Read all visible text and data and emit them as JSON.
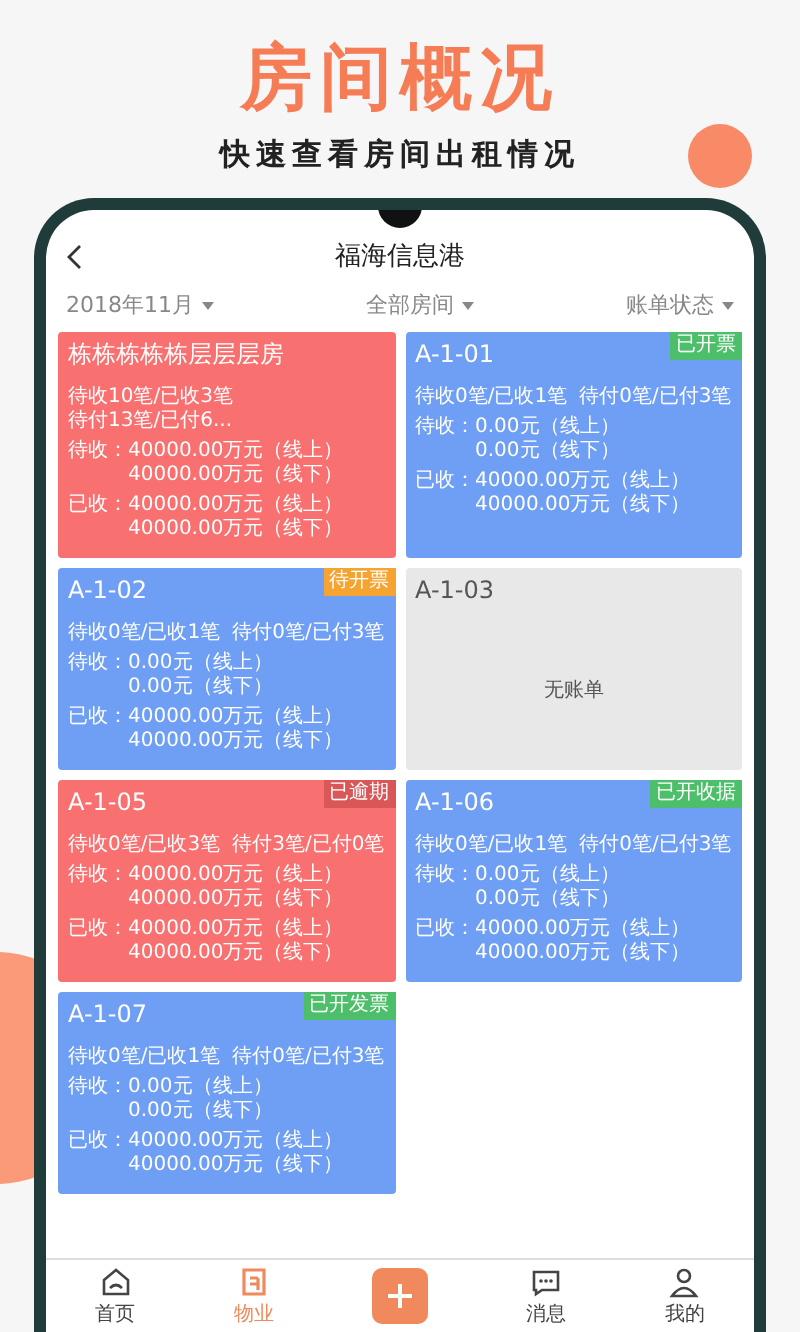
{
  "promo": {
    "title": "房间概况",
    "subtitle": "快速查看房间出租情况"
  },
  "app": {
    "title": "福海信息港",
    "filters": [
      {
        "label": "2018年11月"
      },
      {
        "label": "全部房间"
      },
      {
        "label": "账单状态"
      }
    ],
    "rooms": [
      {
        "kind": "bill",
        "name": "栋栋栋栋栋层层层房",
        "color": "#f87070",
        "stats": [
          "待收10笔/已收3笔",
          "待付13笔/已付6..."
        ],
        "amounts": [
          {
            "label": "待收：",
            "lines": [
              "40000.00万元（线上）",
              "40000.00万元（线下）"
            ]
          },
          {
            "label": "已收：",
            "lines": [
              "40000.00万元（线上）",
              "40000.00万元（线下）"
            ]
          }
        ]
      },
      {
        "kind": "bill",
        "name": "A-1-01",
        "color": "#6f9ff5",
        "badge": {
          "text": "已开票",
          "color": "#4dbf6a"
        },
        "stats": [
          "待收0笔/已收1笔",
          "待付0笔/已付3笔"
        ],
        "amounts": [
          {
            "label": "待收：",
            "lines": [
              "0.00元（线上）",
              "0.00元（线下）"
            ]
          },
          {
            "label": "已收：",
            "lines": [
              "40000.00万元（线上）",
              "40000.00万元（线下）"
            ]
          }
        ]
      },
      {
        "kind": "bill",
        "name": "A-1-02",
        "color": "#6f9ff5",
        "badge": {
          "text": "待开票",
          "color": "#f5a431"
        },
        "stats": [
          "待收0笔/已收1笔",
          "待付0笔/已付3笔"
        ],
        "amounts": [
          {
            "label": "待收：",
            "lines": [
              "0.00元（线上）",
              "0.00元（线下）"
            ]
          },
          {
            "label": "已收：",
            "lines": [
              "40000.00万元（线上）",
              "40000.00万元（线下）"
            ]
          }
        ]
      },
      {
        "kind": "empty",
        "name": "A-1-03",
        "note": "无账单"
      },
      {
        "kind": "bill",
        "name": "A-1-05",
        "color": "#f87070",
        "badge": {
          "text": "已逾期",
          "color": "#d95757"
        },
        "stats": [
          "待收0笔/已收3笔",
          "待付3笔/已付0笔"
        ],
        "amounts": [
          {
            "label": "待收：",
            "lines": [
              "40000.00万元（线上）",
              "40000.00万元（线下）"
            ]
          },
          {
            "label": "已收：",
            "lines": [
              "40000.00万元（线上）",
              "40000.00万元（线下）"
            ]
          }
        ]
      },
      {
        "kind": "bill",
        "name": "A-1-06",
        "color": "#6f9ff5",
        "badge": {
          "text": "已开收据",
          "color": "#4dbf6a"
        },
        "stats": [
          "待收0笔/已收1笔",
          "待付0笔/已付3笔"
        ],
        "amounts": [
          {
            "label": "待收：",
            "lines": [
              "0.00元（线上）",
              "0.00元（线下）"
            ]
          },
          {
            "label": "已收：",
            "lines": [
              "40000.00万元（线上）",
              "40000.00万元（线下）"
            ]
          }
        ]
      },
      {
        "kind": "bill",
        "name": "A-1-07",
        "color": "#6f9ff5",
        "badge": {
          "text": "已开发票",
          "color": "#4dbf6a"
        },
        "stats": [
          "待收0笔/已收1笔",
          "待付0笔/已付3笔"
        ],
        "amounts": [
          {
            "label": "待收：",
            "lines": [
              "0.00元（线上）",
              "0.00元（线下）"
            ]
          },
          {
            "label": "已收：",
            "lines": [
              "40000.00万元（线上）",
              "40000.00万元（线下）"
            ]
          }
        ]
      }
    ],
    "tabs": [
      {
        "kind": "home",
        "label": "首页",
        "selected": false
      },
      {
        "kind": "property",
        "label": "物业",
        "selected": true
      },
      {
        "kind": "add"
      },
      {
        "kind": "message",
        "label": "消息",
        "selected": false
      },
      {
        "kind": "me",
        "label": "我的",
        "selected": false
      }
    ]
  }
}
